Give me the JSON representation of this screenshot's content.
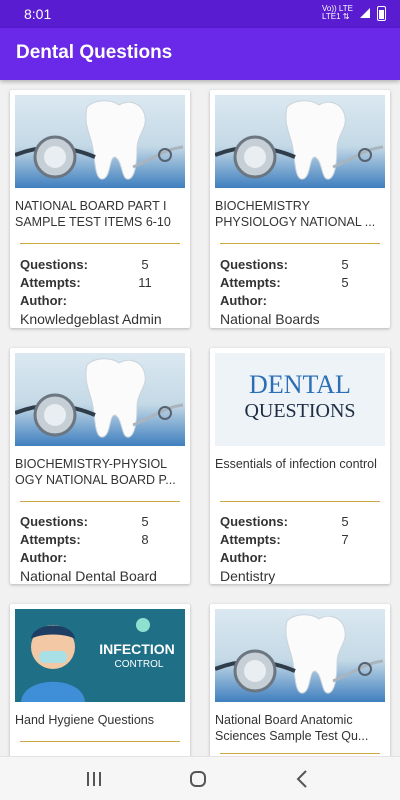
{
  "status_bar": {
    "time": "8:01",
    "network_top": "Vo)) LTE",
    "network_bottom": "LTE1 ⇅"
  },
  "app_bar": {
    "title": "Dental Questions"
  },
  "labels": {
    "questions": "Questions:",
    "attempts": "Attempts:",
    "author": "Author:"
  },
  "cards": [
    {
      "title": "NATIONAL BOARD PART I SAMPLE TEST ITEMS 6-10",
      "questions": "5",
      "attempts": "11",
      "author": "Knowledgeblast Admin",
      "image": "tooth-stethoscope"
    },
    {
      "title": "BIOCHEMISTRY PHYSIOLOGY  NATIONAL ...",
      "questions": "5",
      "attempts": "5",
      "author": "National Boards",
      "image": "tooth-stethoscope"
    },
    {
      "title": "BIOCHEMISTRY-PHYSIOL OGY  NATIONAL BOARD P...",
      "questions": "5",
      "attempts": "8",
      "author": "National Dental Board",
      "image": "tooth-stethoscope"
    },
    {
      "title": "Essentials of infection control",
      "questions": "5",
      "attempts": "7",
      "author": "Dentistry",
      "image": "dental-questions-logo",
      "logo_line1": "DENTAL",
      "logo_line2": "QUESTIONS"
    },
    {
      "title": "Hand Hygiene Questions",
      "image": "infection-control",
      "banner_line1": "INFECTION",
      "banner_line2": "CONTROL"
    },
    {
      "title": "National Board Anatomic Sciences Sample Test Qu...",
      "image": "tooth-stethoscope"
    }
  ],
  "icons": {
    "battery": "battery-icon",
    "nav_recents": "recents-icon",
    "nav_home": "home-icon",
    "nav_back": "back-icon"
  },
  "colors": {
    "status_bar": "#5a1cd0",
    "app_bar": "#6a28e8",
    "divider": "#c9a840",
    "logo_text": "#2a6fb5"
  }
}
